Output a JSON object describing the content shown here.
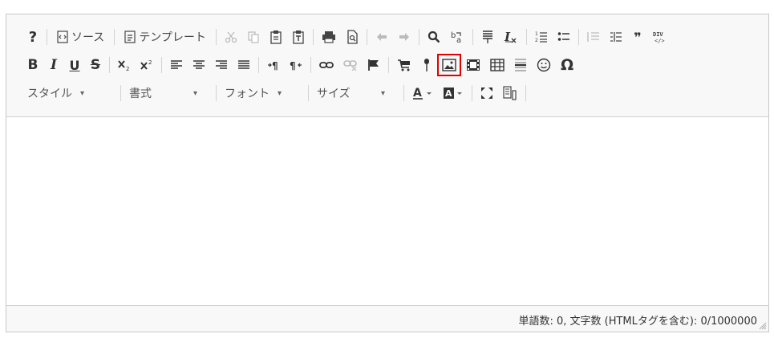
{
  "toolbar": {
    "help_label": "?",
    "source_label": "ソース",
    "template_label": "テンプレート",
    "bold_label": "B",
    "italic_label": "I",
    "underline_label": "U",
    "strike_label": "S",
    "omega_label": "Ω",
    "quote_label": "❞"
  },
  "combos": {
    "style": "スタイル",
    "format": "書式",
    "font": "フォント",
    "size": "サイズ"
  },
  "status": {
    "counter": "単語数: 0, 文字数 (HTMLタグを含む): 0/1000000"
  },
  "colors": {
    "highlight_border": "#e00000",
    "toolbar_bg": "#f8f8f8",
    "border": "#c8c8c8"
  }
}
